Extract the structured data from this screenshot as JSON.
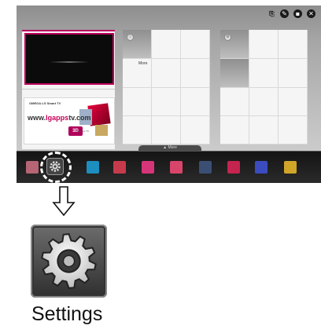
{
  "tv": {
    "top_icons": [
      "input-icon",
      "pencil-icon",
      "chat-icon",
      "close-icon"
    ],
    "card1": {
      "ad_brand": "OMEGA LG Smart TV",
      "ad_url_prefix": "www.",
      "ad_url_brand": "lgapps",
      "ad_url_suffix": "tv.com",
      "ad_3d": "3D",
      "ad_sub": "LG Apps TV"
    },
    "card2": {
      "more_label": "More"
    },
    "more_tab_label": "More",
    "dock_items": [
      {
        "name": "dock-item-1",
        "color": "#b56574"
      },
      {
        "name": "dock-item-settings",
        "color": "#555555"
      },
      {
        "name": "dock-item-3",
        "color": "#1d8ec0"
      },
      {
        "name": "dock-item-4",
        "color": "#c73a4c"
      },
      {
        "name": "dock-item-5",
        "color": "#d6357a"
      },
      {
        "name": "dock-item-6",
        "color": "#d8456a"
      },
      {
        "name": "dock-item-7",
        "color": "#3b4f74"
      },
      {
        "name": "dock-item-8",
        "color": "#c4244f"
      },
      {
        "name": "dock-item-9",
        "color": "#3a4cc0"
      },
      {
        "name": "dock-item-10",
        "color": "#d0a528"
      }
    ]
  },
  "settings": {
    "label": "Settings"
  },
  "colors": {
    "accent": "#c0005a",
    "dock_bg": "#1a1a1a"
  }
}
